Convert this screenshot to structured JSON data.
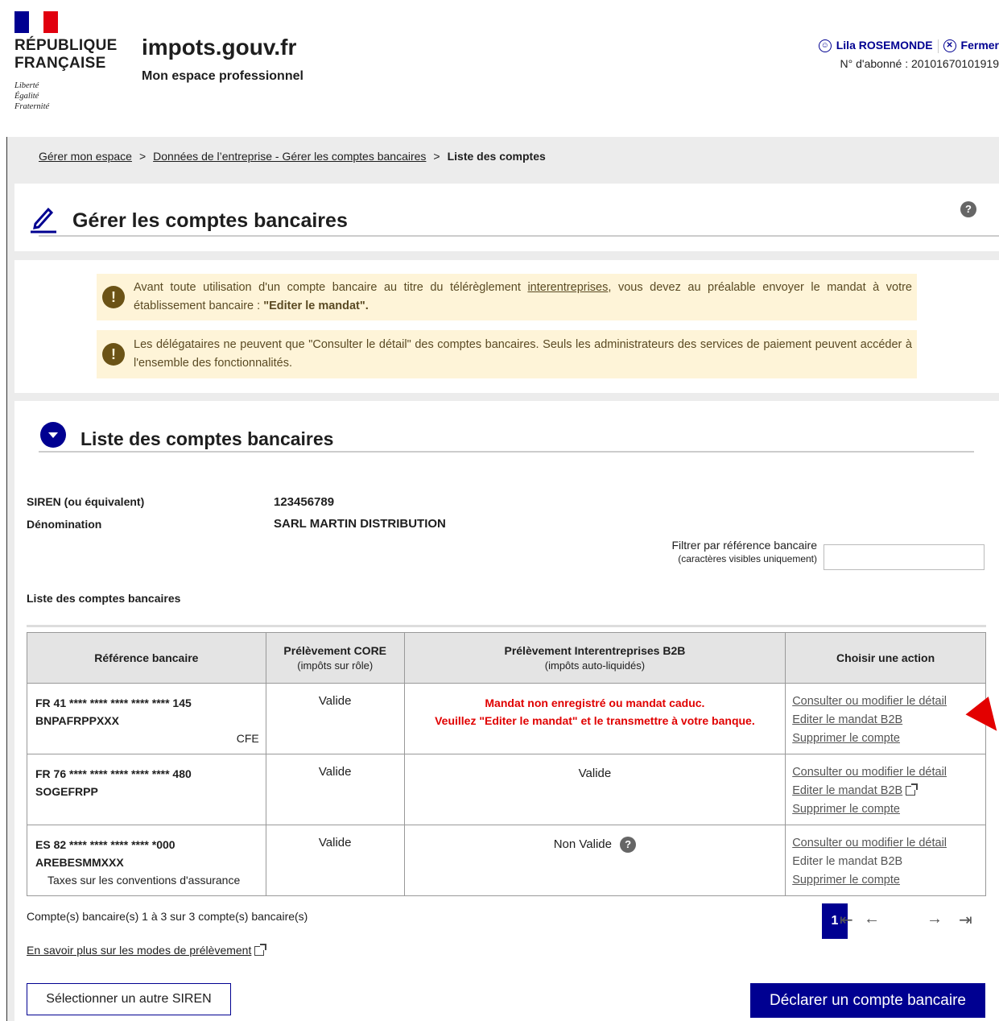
{
  "header": {
    "republique_line1": "RÉPUBLIQUE",
    "republique_line2": "FRANÇAISE",
    "devise_1": "Liberté",
    "devise_2": "Égalité",
    "devise_3": "Fraternité",
    "site_title": "impots.gouv.fr",
    "site_subtitle": "Mon espace professionnel",
    "user_name": "Lila ROSEMONDE",
    "close_label": "Fermer",
    "subscriber": "N° d'abonné : 20101670101919"
  },
  "breadcrumb": {
    "item1": "Gérer mon espace",
    "item2": "Données de l’entreprise - Gérer les comptes bancaires",
    "current": "Liste des comptes",
    "sep": ">"
  },
  "page": {
    "title": "Gérer les comptes bancaires",
    "help_glyph": "?"
  },
  "alerts": {
    "alert1_before": "Avant toute utilisation d'un compte bancaire au titre du télérèglement ",
    "alert1_link": "interentreprises",
    "alert1_after": ", vous devez au préalable envoyer le mandat à votre établissement bancaire : ",
    "alert1_bold": "\"Editer le mandat\".",
    "alert2": "Les délégataires ne peuvent que \"Consulter le détail\" des comptes bancaires. Seuls les administrateurs des services de paiement peuvent accéder à l'ensemble des fonctionnalités.",
    "icon_glyph": "!"
  },
  "section": {
    "title": "Liste des comptes bancaires",
    "siren_label": "SIREN (ou équivalent)",
    "siren_value": "123456789",
    "denomination_label": "Dénomination",
    "denomination_value": "SARL MARTIN DISTRIBUTION",
    "filter_label": "Filtrer par référence bancaire",
    "filter_hint": "(caractères visibles uniquement)",
    "filter_value": "",
    "list_label": "Liste des comptes bancaires"
  },
  "table": {
    "headers": {
      "ref": "Référence bancaire",
      "core": "Prélèvement CORE",
      "core_sub": "(impôts sur rôle)",
      "b2b": "Prélèvement Interentreprises B2B",
      "b2b_sub": "(impôts auto-liquidés)",
      "action": "Choisir une action"
    },
    "rows": [
      {
        "iban": "FR 41 **** **** **** **** **** 145",
        "bic": "BNPAFRPPXXX",
        "note": "CFE",
        "core": "Valide",
        "b2b_error1": "Mandat non enregistré ou mandat caduc.",
        "b2b_error2": "Veuillez \"Editer le mandat\" et le transmettre à votre banque.",
        "action1": "Consulter ou modifier le détail",
        "action2": "Editer le mandat B2B",
        "action3": "Supprimer le compte"
      },
      {
        "iban": "FR 76 **** **** **** **** **** 480",
        "bic": "SOGEFRPP",
        "core": "Valide",
        "b2b": "Valide",
        "action1": "Consulter ou modifier le détail",
        "action2": "Editer le mandat B2B",
        "action3": "Supprimer le compte"
      },
      {
        "iban": "ES 82 **** **** **** **** *000",
        "bic": "AREBESMMXXX",
        "note": "Taxes sur les conventions d'assurance",
        "core": "Valide",
        "b2b": "Non Valide",
        "action1": "Consulter ou modifier le détail",
        "action2": "Editer le mandat B2B",
        "action3": "Supprimer le compte"
      }
    ]
  },
  "footer": {
    "counter": "Compte(s) bancaire(s) 1 à 3 sur 3 compte(s) bancaire(s)",
    "page_current": "1",
    "learn_more": "En savoir plus sur les modes de prélèvement",
    "select_siren": "Sélectionner un autre SIREN",
    "declare": "Déclarer un compte bancaire"
  },
  "colors": {
    "brand_blue": "#000091",
    "marianne_red": "#e1000f",
    "alert_bg": "#fef4d8",
    "error_red": "#e00000"
  }
}
